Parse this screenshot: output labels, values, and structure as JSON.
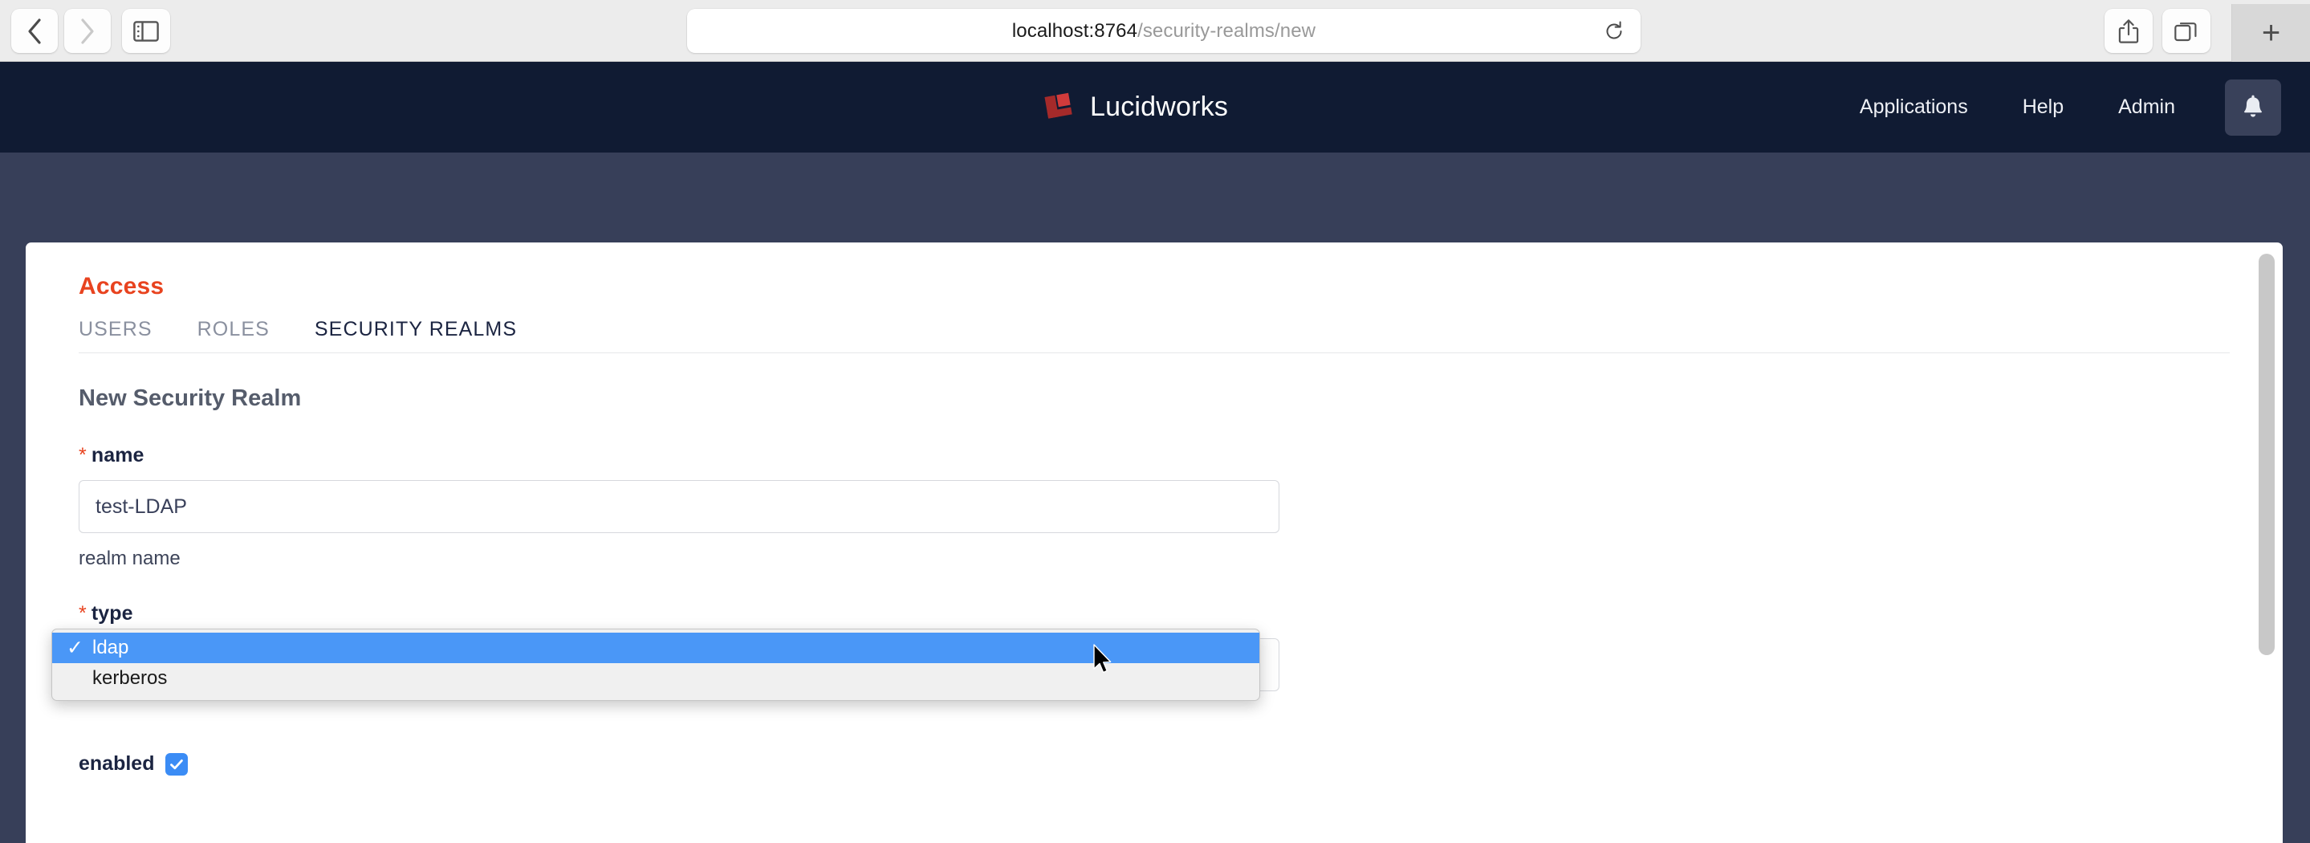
{
  "browser": {
    "back_label": "Back",
    "forward_label": "Forward",
    "sidebar_label": "Show sidebar",
    "url_host": "localhost:8764",
    "url_path": "/security-realms/new",
    "url_full": "localhost:8764/security-realms/new",
    "reload_label": "Reload",
    "share_label": "Share",
    "tabs_label": "Tab Overview",
    "new_tab_label": "+"
  },
  "header": {
    "brand": "Lucidworks",
    "brand_mark_color": "#c0352f",
    "background": "#101b33",
    "nav": [
      {
        "label": "Applications"
      },
      {
        "label": "Help"
      },
      {
        "label": "Admin"
      }
    ],
    "notifications_label": "Notifications"
  },
  "page": {
    "background": "#373f59",
    "accent": "#e8431f",
    "section": {
      "title": "Access",
      "tabs": [
        {
          "label": "USERS",
          "active": false
        },
        {
          "label": "ROLES",
          "active": false
        },
        {
          "label": "SECURITY REALMS",
          "active": true
        }
      ]
    },
    "form": {
      "title": "New Security Realm",
      "required_marker": "*",
      "name_field": {
        "label": "name",
        "value": "test-LDAP",
        "placeholder": "",
        "helper": "realm name"
      },
      "type_field": {
        "label": "type",
        "value": "ldap",
        "options": [
          {
            "label": "ldap",
            "selected": true,
            "check": "✓"
          },
          {
            "label": "kerberos",
            "selected": false,
            "check": ""
          }
        ],
        "highlight_color": "#4a97f7"
      },
      "enabled_field": {
        "label": "enabled",
        "checked": true,
        "check_glyph": "✓",
        "color": "#3b8cf5"
      }
    }
  }
}
